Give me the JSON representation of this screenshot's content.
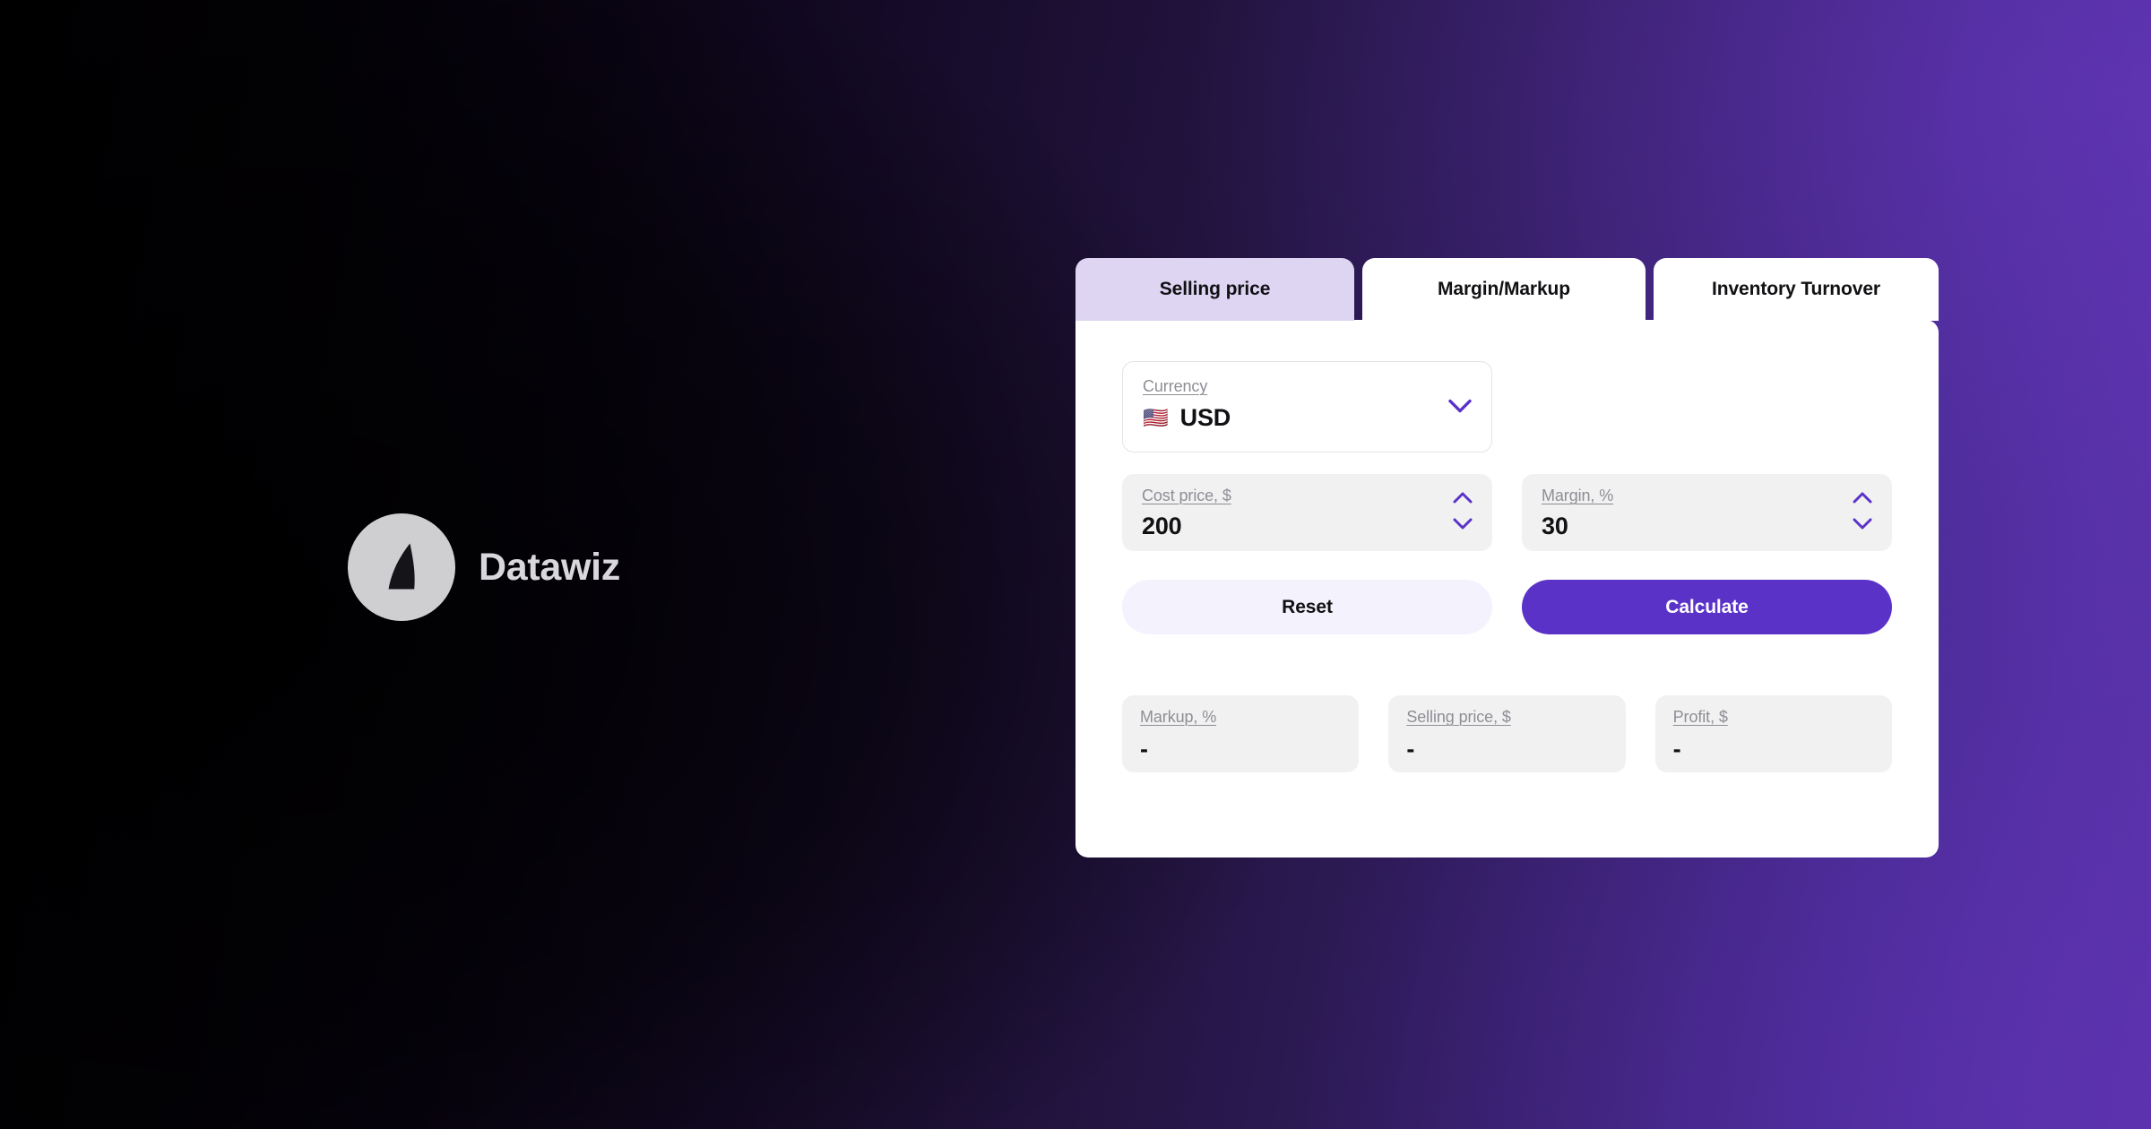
{
  "brand": {
    "name": "Datawiz",
    "logo_icon": "datawiz-droplet-logo"
  },
  "theme": {
    "accent": "#5B32C8",
    "active_tab_bg": "#DDD5F2",
    "card_bg": "#FFFFFF",
    "field_bg": "#F1F1F1",
    "reset_bg": "#F4F2FC",
    "background_gradient_from": "#000000",
    "background_gradient_mid": "#1F1238",
    "background_gradient_to": "#5A2FA8"
  },
  "calculator": {
    "tabs": [
      {
        "label": "Selling price",
        "active": true
      },
      {
        "label": "Margin/Markup",
        "active": false
      },
      {
        "label": "Inventory Turnover",
        "active": false
      }
    ],
    "currency": {
      "label": "Currency",
      "value": "USD",
      "flag": "🇺🇸",
      "chevron_icon": "chevron-down-icon"
    },
    "inputs": [
      {
        "label": "Cost price, $",
        "value": "200",
        "up_icon": "chevron-up-icon",
        "down_icon": "chevron-down-icon"
      },
      {
        "label": "Margin, %",
        "value": "30",
        "up_icon": "chevron-up-icon",
        "down_icon": "chevron-down-icon"
      }
    ],
    "actions": {
      "reset_label": "Reset",
      "calculate_label": "Calculate"
    },
    "results": [
      {
        "label": "Markup, %",
        "value": "-"
      },
      {
        "label": "Selling price, $",
        "value": "-"
      },
      {
        "label": "Profit, $",
        "value": "-"
      }
    ]
  }
}
